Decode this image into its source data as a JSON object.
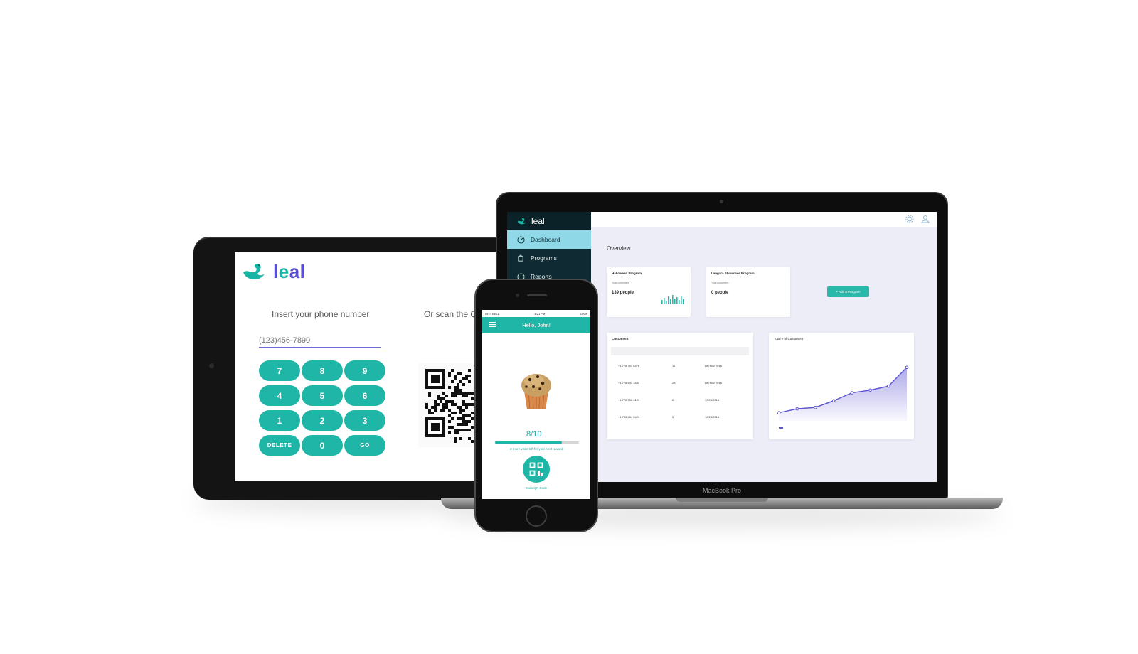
{
  "tablet": {
    "brand": "leal",
    "phone_prompt": "Insert your phone number",
    "scan_prompt": "Or scan the QR c",
    "phone_placeholder": "(123)456-7890",
    "keys": [
      "7",
      "8",
      "9",
      "4",
      "5",
      "6",
      "1",
      "2",
      "3",
      "DELETE",
      "0",
      "GO"
    ]
  },
  "laptop": {
    "brand": "MacBook Pro",
    "app_name": "leal",
    "nav": [
      {
        "label": "Dashboard",
        "icon": "dashboard-icon",
        "active": true
      },
      {
        "label": "Programs",
        "icon": "puzzle-icon",
        "active": false
      },
      {
        "label": "Reports",
        "icon": "pie-chart-icon",
        "active": false
      }
    ],
    "overview_title": "Overview",
    "programs": [
      {
        "title": "Halloween Program",
        "subtitle": "Total customers",
        "count": "139 people"
      },
      {
        "title": "Langara Showcase Program",
        "subtitle": "Total customers",
        "count": "0 people"
      }
    ],
    "add_program_label": "+ Add a Program",
    "customers": {
      "title": "Customers",
      "rows": [
        [
          "+1 778 751 6478",
          "12",
          "8th Nov 2018"
        ],
        [
          "+1 778 643 3454",
          "23",
          "8th Nov 2018"
        ],
        [
          "+1 778 756 0123",
          "2",
          "30/06/2018"
        ],
        [
          "+1 765 654 5421",
          "5",
          "12/23/2018"
        ]
      ]
    },
    "chart_title": "Total # of Customers",
    "accent": "#2ab8aa",
    "sidebar_color": "#0f2a33"
  },
  "phone": {
    "carrier": "•••○○ BELL",
    "time": "4:21 PM",
    "battery": "100%",
    "greeting": "Hello, John!",
    "progress_text": "8/10",
    "progress_fraction": 0.8,
    "hint": "2 more visits left for your next reward",
    "scan_label": "Scan QR Code"
  },
  "chart_data": {
    "type": "area",
    "title": "Total # of Customers",
    "x": [
      1,
      2,
      3,
      4,
      5,
      6,
      7,
      8
    ],
    "values": [
      12,
      18,
      20,
      30,
      42,
      46,
      52,
      80
    ],
    "ylim": [
      0,
      100
    ],
    "grid": false,
    "legend": "bottom-left"
  }
}
